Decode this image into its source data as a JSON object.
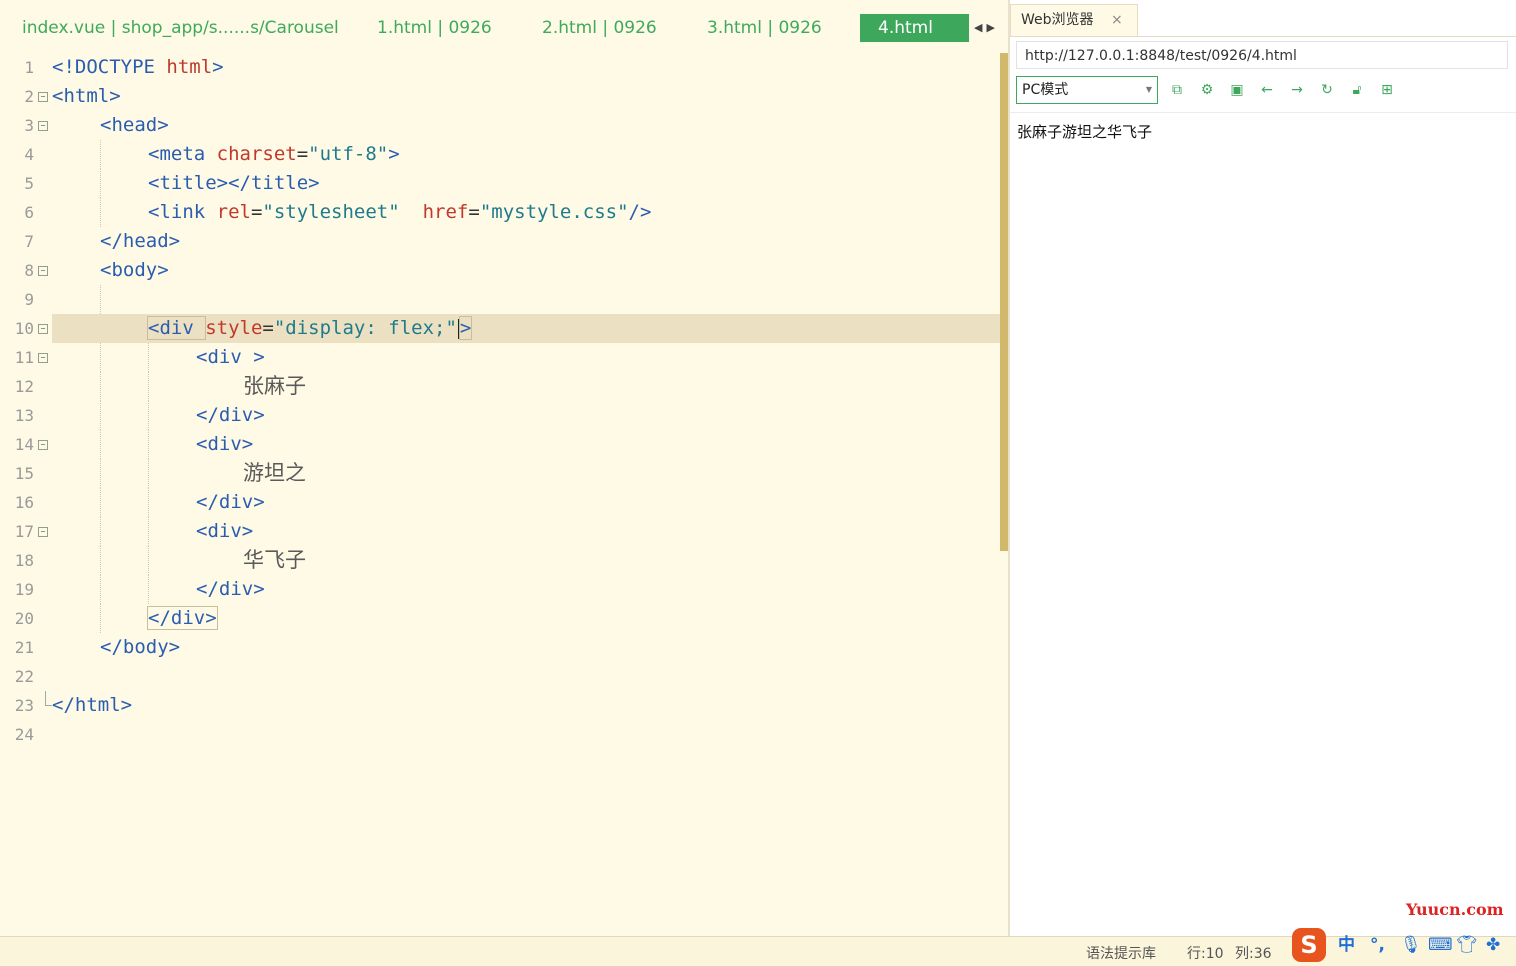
{
  "editor": {
    "tabs": [
      {
        "label": "index.vue | shop_app/s......s/Carousel",
        "active": false
      },
      {
        "label": "1.html | 0926",
        "active": false
      },
      {
        "label": "2.html | 0926",
        "active": false
      },
      {
        "label": "3.html | 0926",
        "active": false
      },
      {
        "label": "4.html",
        "active": true
      }
    ],
    "tab_nav_icons": [
      "tab-prev-icon",
      "tab-next-icon"
    ],
    "line_numbers": [
      "1",
      "2",
      "3",
      "4",
      "5",
      "6",
      "7",
      "8",
      "9",
      "10",
      "11",
      "12",
      "13",
      "14",
      "15",
      "16",
      "17",
      "18",
      "19",
      "20",
      "21",
      "22",
      "23",
      "24"
    ],
    "lines": {
      "l1_a": "<!DOCTYPE ",
      "l1_b": "html",
      "l1_c": ">",
      "l2": "<html>",
      "l3": "<head>",
      "l4_a": "<meta ",
      "l4_b": "charset",
      "l4_c": "=",
      "l4_d": "\"utf-8\"",
      "l4_e": ">",
      "l5": "<title></title>",
      "l6_a": "<link ",
      "l6_b": "rel",
      "l6_c": "=",
      "l6_d": "\"stylesheet\"",
      "l6_e": "  ",
      "l6_f": "href",
      "l6_g": "=",
      "l6_h": "\"mystyle.css\"",
      "l6_i": "/>",
      "l7": "</head>",
      "l8": "<body>",
      "l10_a": "<div ",
      "l10_b": "style",
      "l10_c": "=",
      "l10_d": "\"display: flex;\"",
      "l10_e": ">",
      "l11": "<div >",
      "l12": "张麻子",
      "l13": "</div>",
      "l14": "<div>",
      "l15": "游坦之",
      "l16": "</div>",
      "l17": "<div>",
      "l18": "华飞子",
      "l19": "</div>",
      "l20": "</div>",
      "l21": "</body>",
      "l23": "</html>"
    },
    "fold_marker": "−",
    "colors": {
      "tag": "#2a5db0",
      "attr": "#c0392b",
      "value": "#1f7a8c",
      "active_tab": "#3da85c",
      "current_line": "#ece0c2"
    }
  },
  "browser": {
    "tab_title": "Web浏览器",
    "tab_close": "×",
    "url": "http://127.0.0.1:8848/test/0926/4.html",
    "mode_select": "PC模式",
    "toolbar_icons": [
      "open-external-icon",
      "settings-icon",
      "console-icon",
      "back-arrow-icon",
      "forward-arrow-icon",
      "refresh-icon",
      "lock-icon",
      "grid-icon"
    ],
    "rendered_text": "张麻子游坦之华飞子"
  },
  "watermark": "Yuucn.com",
  "status": {
    "syntax": "语法提示库",
    "row": "行:10",
    "col": "列:36"
  },
  "ime": {
    "logo": "S",
    "items": [
      "中",
      "°,",
      "mic-icon",
      "keyboard-icon",
      "shirt-icon",
      "apps-icon"
    ]
  }
}
